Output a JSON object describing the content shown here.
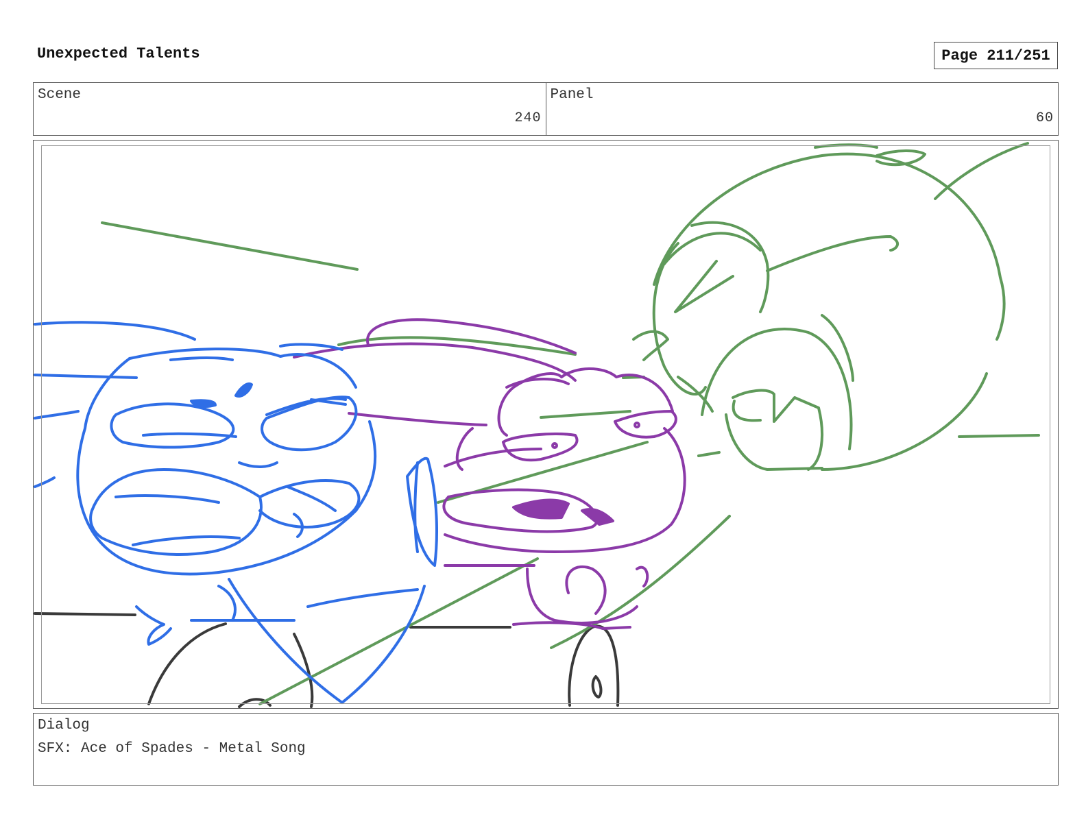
{
  "header": {
    "title": "Unexpected Talents",
    "page": "Page 211/251"
  },
  "info": {
    "scene_label": "Scene",
    "scene_value": "240",
    "panel_label": "Panel",
    "panel_value": "60"
  },
  "panel": {
    "colors": {
      "blue": "#2f6ee6",
      "purple": "#8b3aa8",
      "green": "#5f9a5a",
      "dark": "#3a3a3a"
    }
  },
  "dialog": {
    "label": "Dialog",
    "text": "SFX: Ace of Spades - Metal Song"
  }
}
